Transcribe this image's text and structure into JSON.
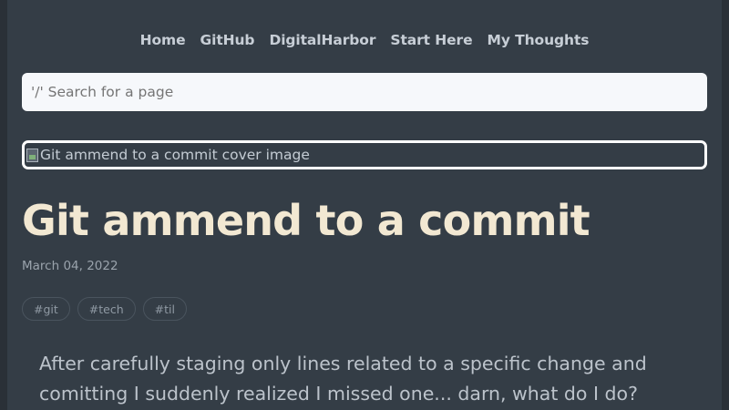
{
  "nav": {
    "items": [
      "Home",
      "GitHub",
      "DigitalHarbor",
      "Start Here",
      "My Thoughts"
    ]
  },
  "search": {
    "placeholder": "'/' Search for a page"
  },
  "post": {
    "cover_alt": "Git ammend to a commit cover image",
    "title": "Git ammend to a commit",
    "date": "March 04, 2022",
    "tags": [
      "#git",
      "#tech",
      "#til"
    ],
    "intro": "After carefully staging only lines related to a specific change and comitting I suddenly realized I missed one... darn, what do I do?"
  },
  "colors": {
    "page_bg": "#343d46",
    "title": "#f2e8d2",
    "nav_text": "#c7ced6",
    "search_bg": "#f6f8fb"
  }
}
